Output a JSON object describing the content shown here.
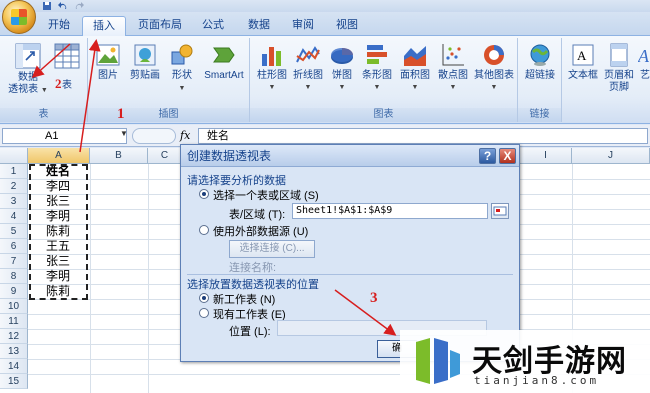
{
  "tabs": [
    "开始",
    "插入",
    "页面布局",
    "公式",
    "数据",
    "审阅",
    "视图"
  ],
  "active_tab": "插入",
  "ribbon": {
    "tables": {
      "label": "表",
      "pivot_line1": "数据",
      "pivot_line2": "透视表",
      "table": "表"
    },
    "illustrations": {
      "label": "插图",
      "picture": "图片",
      "clipart": "剪贴画",
      "shapes": "形状",
      "smartart": "SmartArt"
    },
    "charts": {
      "label": "图表",
      "column": "柱形图",
      "line": "折线图",
      "pie": "饼图",
      "bar": "条形图",
      "area": "面积图",
      "scatter": "散点图",
      "other": "其他图表"
    },
    "links": {
      "label": "链接",
      "hyperlink": "超链接"
    },
    "text": {
      "textbox": "文本框",
      "header_line1": "页眉和",
      "header_line2": "页脚",
      "more": "艺"
    }
  },
  "formula_bar": {
    "name_box": "A1",
    "fx": "fx",
    "content": "姓名"
  },
  "columns": [
    "A",
    "B",
    "C",
    "I",
    "J"
  ],
  "rows": [
    "1",
    "2",
    "3",
    "4",
    "5",
    "6",
    "7",
    "8",
    "9",
    "10",
    "11",
    "12",
    "13",
    "14",
    "15"
  ],
  "column_a": [
    "姓名",
    "李四",
    "张三",
    "李明",
    "陈莉",
    "王五",
    "张三",
    "李明",
    "陈莉"
  ],
  "dialog": {
    "title": "创建数据透视表",
    "help": "?",
    "close": "X",
    "section1": "请选择要分析的数据",
    "opt_select_table": "选择一个表或区域 (S)",
    "table_range_label": "表/区域 (T):",
    "table_range_value": "Sheet1!$A$1:$A$9",
    "opt_external": "使用外部数据源 (U)",
    "choose_connection": "选择连接 (C)...",
    "connection_name": "连接名称:",
    "section2": "选择放置数据透视表的位置",
    "opt_new_sheet": "新工作表 (N)",
    "opt_existing_sheet": "现有工作表 (E)",
    "location_label": "位置 (L):",
    "ok": "确"
  },
  "annotations": {
    "n1": "1",
    "n2": "2",
    "n3": "3"
  },
  "watermark": {
    "title": "天剑手游网",
    "url": "tianjian8.com"
  },
  "colors": {
    "ribbon_blue": "#15428b",
    "annotation_red": "#d71e1e"
  }
}
